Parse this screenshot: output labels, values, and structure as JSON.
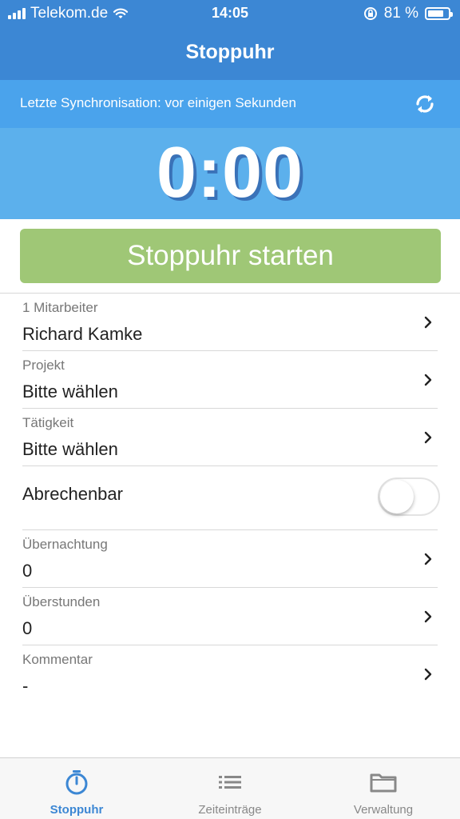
{
  "status_bar": {
    "carrier": "Telekom.de",
    "time": "14:05",
    "battery_percent": "81 %",
    "battery_level": 0.81
  },
  "nav": {
    "title": "Stoppuhr"
  },
  "sync": {
    "text": "Letzte Synchronisation: vor einigen Sekunden",
    "icon": "sync-icon"
  },
  "timer": {
    "value": "0:00"
  },
  "start_button": {
    "label": "Stoppuhr starten"
  },
  "rows": {
    "employee": {
      "label": "1 Mitarbeiter",
      "value": "Richard Kamke"
    },
    "project": {
      "label": "Projekt",
      "value": "Bitte wählen"
    },
    "activity": {
      "label": "Tätigkeit",
      "value": "Bitte wählen"
    },
    "billable": {
      "label": "Abrechenbar",
      "on": false
    },
    "overnight": {
      "label": "Übernachtung",
      "value": "0"
    },
    "overtime": {
      "label": "Überstunden",
      "value": "0"
    },
    "comment": {
      "label": "Kommentar",
      "value": "-"
    }
  },
  "tabs": [
    {
      "label": "Stoppuhr",
      "icon": "stopwatch-icon",
      "active": true
    },
    {
      "label": "Zeiteinträge",
      "icon": "list-icon",
      "active": false
    },
    {
      "label": "Verwaltung",
      "icon": "folder-icon",
      "active": false
    }
  ],
  "colors": {
    "primary": "#3c87d4",
    "sync_bar": "#4aa3ec",
    "timer_bg": "#5cb0ec",
    "start_button": "#9fc776",
    "tab_active": "#3c87d4",
    "tab_inactive": "#888888"
  }
}
